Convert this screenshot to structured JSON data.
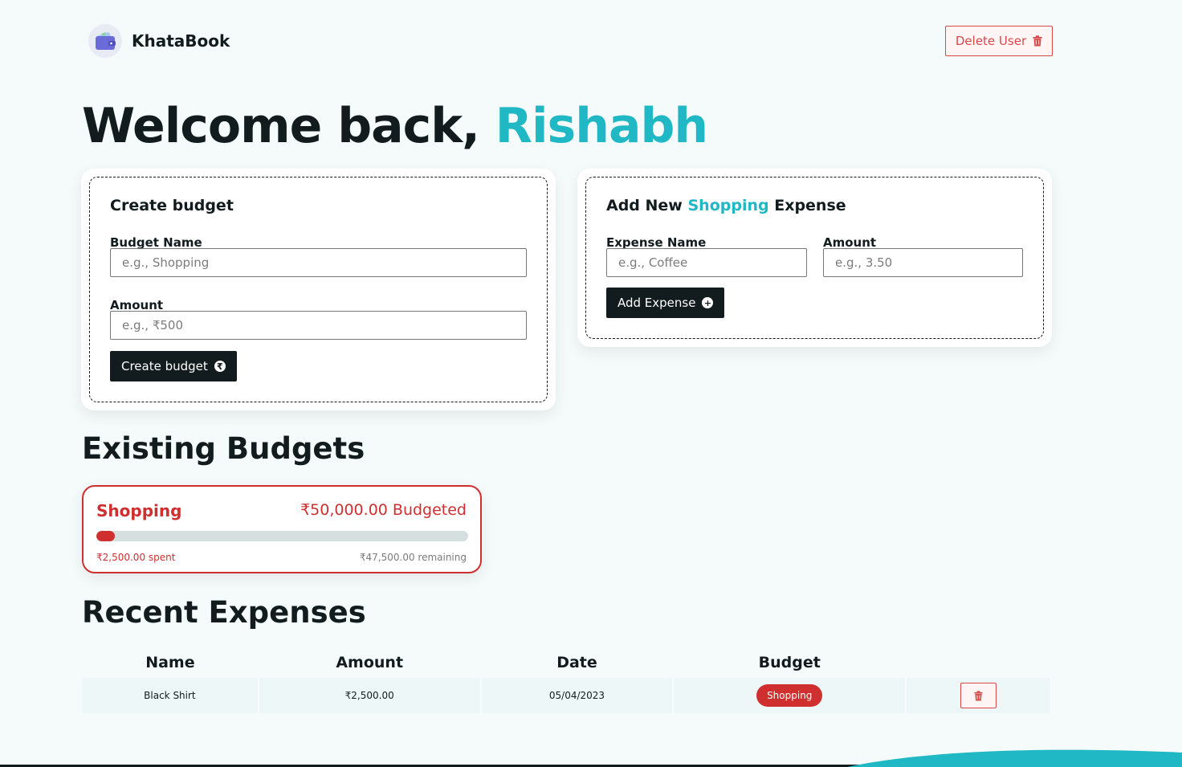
{
  "brand": {
    "name": "KhataBook",
    "icon": "wallet-icon"
  },
  "header": {
    "delete_user_label": "Delete User",
    "delete_icon": "trash-icon"
  },
  "welcome": {
    "prefix": "Welcome back, ",
    "name": "Rishabh"
  },
  "create_budget": {
    "title": "Create budget",
    "name_label": "Budget Name",
    "name_placeholder": "e.g., Shopping",
    "amount_label": "Amount",
    "amount_placeholder": "e.g., ₹500",
    "button_label": "Create budget",
    "button_icon": "rupee-circle-icon"
  },
  "add_expense": {
    "title_prefix": "Add New ",
    "title_accent": "Shopping",
    "title_suffix": " Expense",
    "name_label": "Expense Name",
    "name_placeholder": "e.g., Coffee",
    "amount_label": "Amount",
    "amount_placeholder": "e.g., 3.50",
    "button_label": "Add Expense",
    "button_icon": "plus-circle-icon"
  },
  "existing_budgets": {
    "heading": "Existing Budgets",
    "items": [
      {
        "name": "Shopping",
        "budgeted": "₹50,000.00 Budgeted",
        "spent": "₹2,500.00 spent",
        "remaining": "₹47,500.00 remaining",
        "progress_fraction": 0.05,
        "color": "#cf2f2f"
      }
    ]
  },
  "recent_expenses": {
    "heading": "Recent Expenses",
    "columns": [
      "Name",
      "Amount",
      "Date",
      "Budget",
      ""
    ],
    "rows": [
      {
        "name": "Black Shirt",
        "amount": "₹2,500.00",
        "date": "05/04/2023",
        "budget": "Shopping"
      }
    ]
  },
  "colors": {
    "accent": "#1fb8c4",
    "danger": "#cf2f2f",
    "dark": "#121c1f",
    "background": "#f5fbfb"
  }
}
